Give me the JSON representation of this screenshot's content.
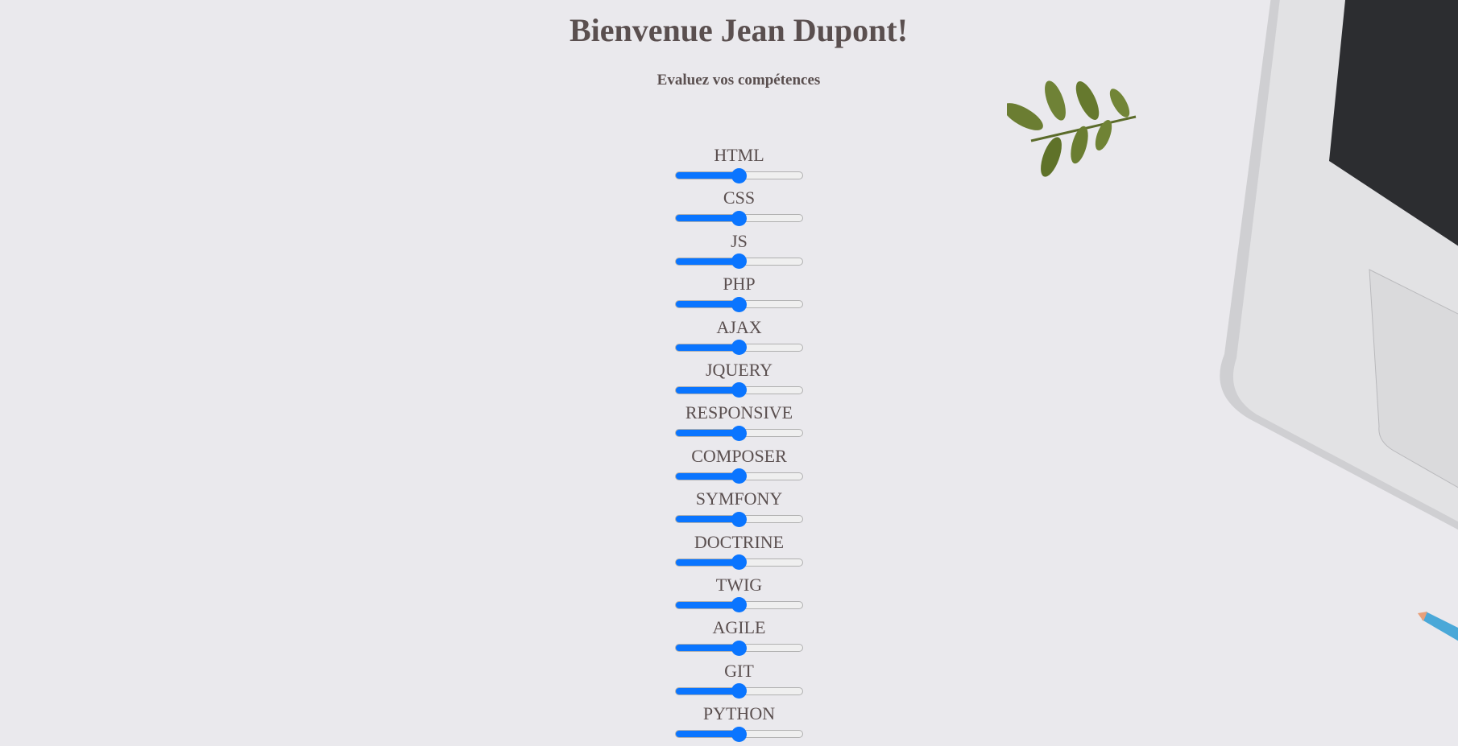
{
  "header": {
    "title": "Bienvenue Jean Dupont!",
    "subtitle": "Evaluez vos compétences"
  },
  "skills": [
    {
      "label": "HTML",
      "value": 50
    },
    {
      "label": "CSS",
      "value": 50
    },
    {
      "label": "JS",
      "value": 50
    },
    {
      "label": "PHP",
      "value": 50
    },
    {
      "label": "AJAX",
      "value": 50
    },
    {
      "label": "JQUERY",
      "value": 50
    },
    {
      "label": "RESPONSIVE",
      "value": 50
    },
    {
      "label": "COMPOSER",
      "value": 50
    },
    {
      "label": "SYMFONY",
      "value": 50
    },
    {
      "label": "DOCTRINE",
      "value": 50
    },
    {
      "label": "TWIG",
      "value": 50
    },
    {
      "label": "AGILE",
      "value": 50
    },
    {
      "label": "GIT",
      "value": 50
    },
    {
      "label": "PYTHON",
      "value": 50
    }
  ],
  "colors": {
    "accent": "#0a75ff",
    "text": "#5a4f4f",
    "background": "#eae9ed"
  }
}
